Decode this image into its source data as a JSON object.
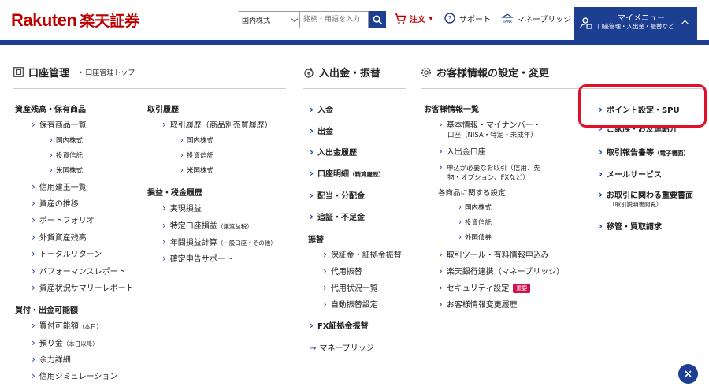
{
  "header": {
    "logo_latin": "Rakuten",
    "logo_jp": "楽天証券",
    "search_select": "国内株式",
    "search_placeholder": "銘柄・用語を入力",
    "order": "注文",
    "support": "サポート",
    "bridge": "マネーブリッジ",
    "bank_label": "BANK",
    "mymenu_title": "マイメニュー",
    "mymenu_sub": "口座管理・入出金・振替など"
  },
  "sections": {
    "account": {
      "title": "口座管理",
      "crumb": "口座管理トップ"
    },
    "deposit": {
      "title": "入出金・振替"
    },
    "settings": {
      "title": "お客様情報の設定・変更"
    }
  },
  "col1": {
    "cat1": "資産残高・保有商品",
    "i1": "保有商品一覧",
    "i1a": "国内株式",
    "i1b": "投資信託",
    "i1c": "米国株式",
    "i2": "信用建玉一覧",
    "i3": "資産の推移",
    "i4": "ポートフォリオ",
    "i5": "外貨資産残高",
    "i6": "トータルリターン",
    "i7": "パフォーマンスレポート",
    "i8": "資産状況サマリーレポート",
    "cat2": "買付・出金可能額",
    "j1": "買付可能額",
    "j1s": "（本日）",
    "j2": "預り金",
    "j2s": "（本日以降）",
    "j3": "余力詳細",
    "j4": "信用シミュレーション"
  },
  "col2": {
    "cat1": "取引履歴",
    "i1": "取引履歴（商品別売買履歴）",
    "i1a": "国内株式",
    "i1b": "投資信託",
    "i1c": "米国株式",
    "cat2": "損益・税金履歴",
    "j1": "実現損益",
    "j2": "特定口座損益",
    "j2s": "（譲渡益税）",
    "j3": "年間損益計算",
    "j3s": "（一般口座・その他）",
    "j4": "確定申告サポート"
  },
  "col3": {
    "i1": "入金",
    "i2": "出金",
    "i3": "入出金履歴",
    "i4": "口座明細",
    "i4s": "（精算履歴）",
    "i5": "配当・分配金",
    "i6": "追証・不足金",
    "cat": "振替",
    "k1": "保証金・証拠金振替",
    "k2": "代用振替",
    "k3": "代用状況一覧",
    "k4": "自動振替設定",
    "fx": "FX証拠金振替",
    "bridge": "マネーブリッジ"
  },
  "col4": {
    "cat": "お客様情報一覧",
    "i1a": "基本情報・マイナンバー・",
    "i1b": "口座（NISA・特定・未成年）",
    "i2": "入出金口座",
    "i3a": "申込が必要なお取引（信用、先",
    "i3b": "物・オプション、FXなど）",
    "sub": "各商品に関する設定",
    "s1": "国内株式",
    "s2": "投資信託",
    "s3": "外国債券",
    "i4": "取引ツール・有料情報申込み",
    "i5": "楽天銀行連携（マネーブリッジ）",
    "i6": "セキュリティ設定",
    "i6badge": "重要",
    "i7": "お客様情報変更履歴"
  },
  "col5": {
    "i1": "ポイント設定・SPU",
    "i2": "ご家族・お友達紹介",
    "i3": "取引報告書等",
    "i3s": "（電子書面）",
    "i4": "メールサービス",
    "i5": "お取引に関わる重要書面",
    "i5s": "（取引説明書閲覧）",
    "i6": "移管・買取請求"
  },
  "colors": {
    "brand_red": "#bf0000",
    "navy": "#1d3f91",
    "highlight": "#e0102a",
    "badge": "#d0104c"
  }
}
